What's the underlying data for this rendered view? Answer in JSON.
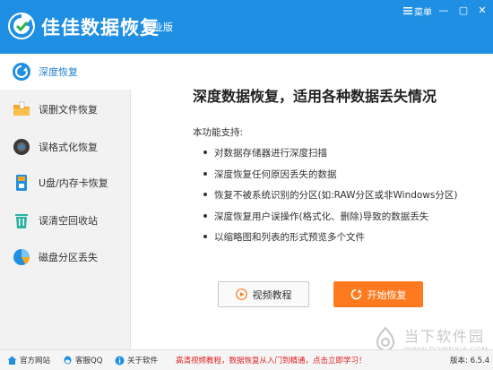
{
  "window": {
    "app_title": "佳佳数据恢复",
    "edition": "专业版",
    "menu_label": "菜单",
    "minimize_glyph": "—",
    "maximize_glyph": "▢",
    "close_glyph": "✕"
  },
  "colors": {
    "titlebar": "#1f8fe3",
    "accent_blue": "#1f7fd0",
    "accent_orange": "#ff7a1f",
    "promo_red": "#e02020"
  },
  "sidebar": {
    "active_index": 0,
    "items": [
      {
        "label": "深度恢复",
        "icon": "refresh-icon"
      },
      {
        "label": "误删文件恢复",
        "icon": "folder-icon"
      },
      {
        "label": "误格式化恢复",
        "icon": "disk-icon"
      },
      {
        "label": "U盘/内存卡恢复",
        "icon": "usb-drive-icon"
      },
      {
        "label": "误清空回收站",
        "icon": "recycle-bin-icon"
      },
      {
        "label": "磁盘分区丢失",
        "icon": "pie-chart-icon"
      }
    ]
  },
  "main": {
    "heading": "深度数据恢复，适用各种数据丢失情况",
    "support_label": "本功能支持:",
    "features": [
      "对数据存储器进行深度扫描",
      "深度恢复任何原因丢失的数据",
      "恢复不被系统识别的分区(如:RAW分区或非Windows分区)",
      "深度恢复用户误操作(格式化、删除)导致的数据丢失",
      "以缩略图和列表的形式预览多个文件"
    ],
    "video_button": "视频教程",
    "start_button": "开始恢复"
  },
  "watermark": {
    "title": "当下软件园",
    "url": "WWW.DOWNXIA.COM"
  },
  "footer": {
    "official_site": "官方网站",
    "support_qq": "客服QQ",
    "about": "关于软件",
    "promo": "高清视频教程，数据恢复从入门到精通，点击立即学习！",
    "version": "版本: 6.5.4"
  }
}
